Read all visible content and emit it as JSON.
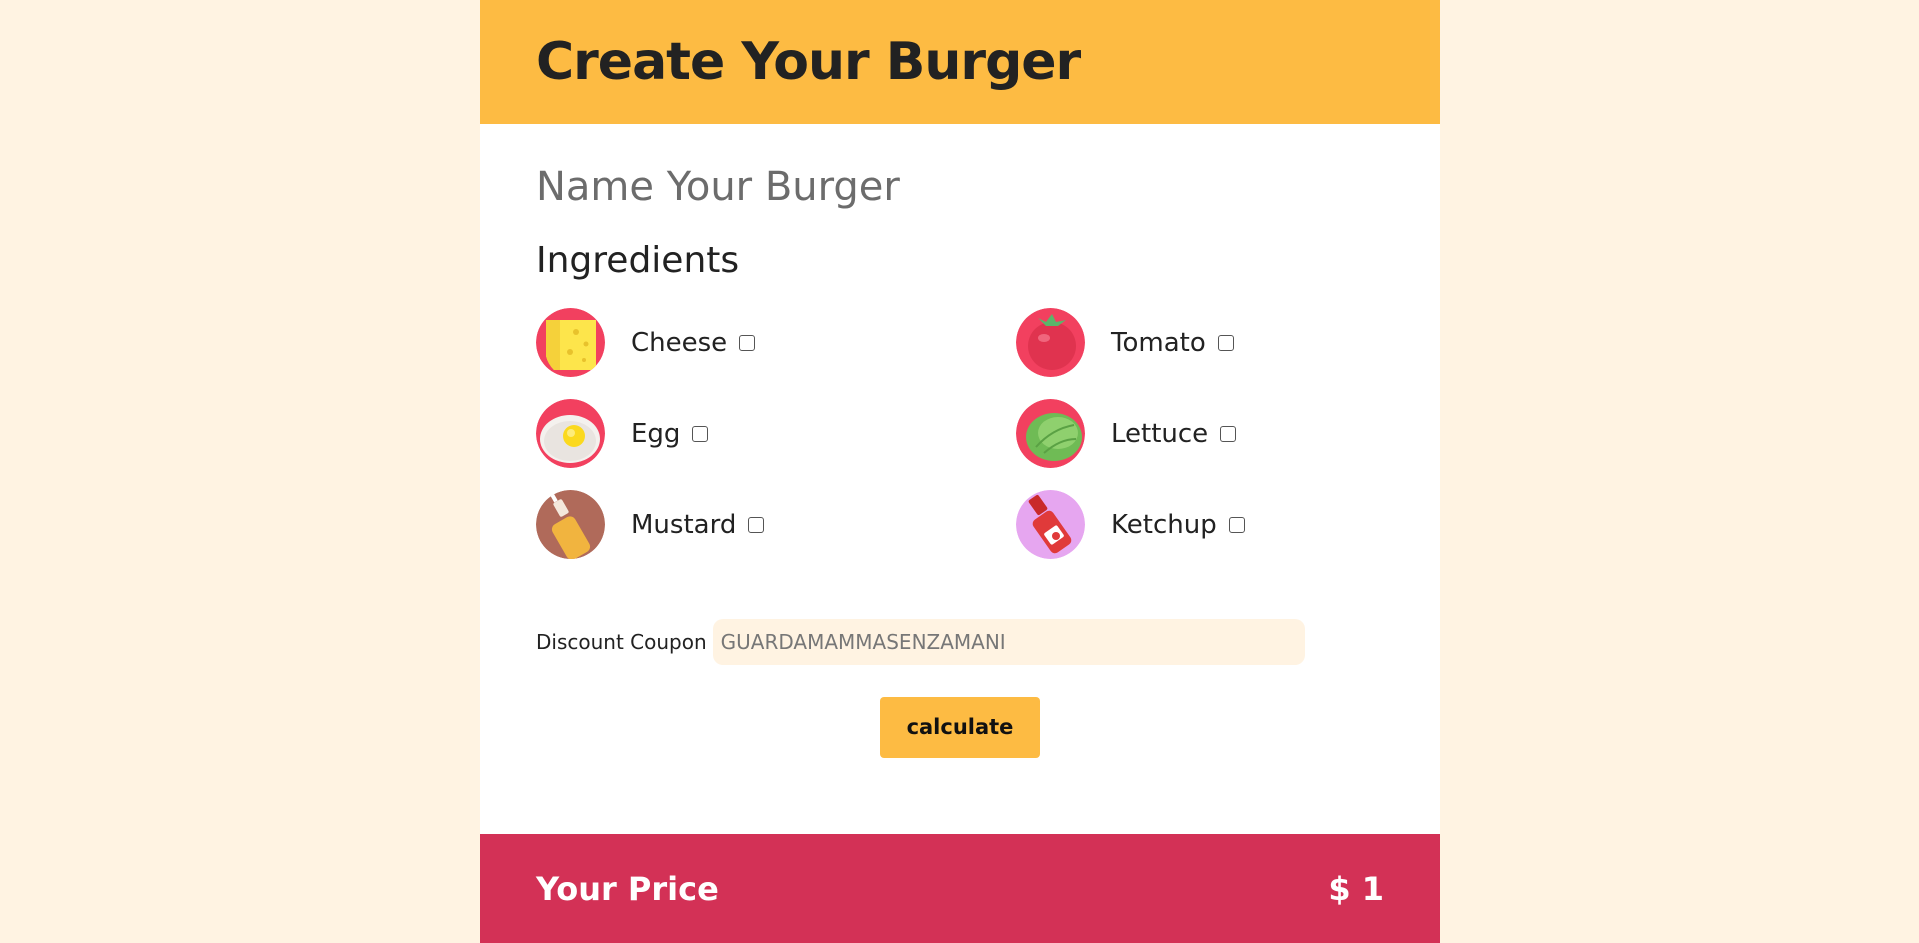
{
  "header": {
    "title": "Create Your Burger"
  },
  "form": {
    "name_placeholder": "Name Your Burger",
    "ingredients_title": "Ingredients",
    "ingredients": [
      {
        "label": "Cheese",
        "icon": "cheese-icon",
        "checked": false
      },
      {
        "label": "Tomato",
        "icon": "tomato-icon",
        "checked": false
      },
      {
        "label": "Egg",
        "icon": "egg-icon",
        "checked": false
      },
      {
        "label": "Lettuce",
        "icon": "lettuce-icon",
        "checked": false
      },
      {
        "label": "Mustard",
        "icon": "mustard-icon",
        "checked": false
      },
      {
        "label": "Ketchup",
        "icon": "ketchup-icon",
        "checked": false
      }
    ],
    "coupon_label": "Discount Coupon",
    "coupon_value": "GUARDAMAMMASENZAMANI",
    "calculate_label": "calculate"
  },
  "footer": {
    "price_label": "Your Price",
    "price_value": "$ 1"
  },
  "colors": {
    "page_bg": "#fff3e2",
    "header_bg": "#fdbb43",
    "button_bg": "#fdbb43",
    "footer_bg": "#d33156"
  }
}
